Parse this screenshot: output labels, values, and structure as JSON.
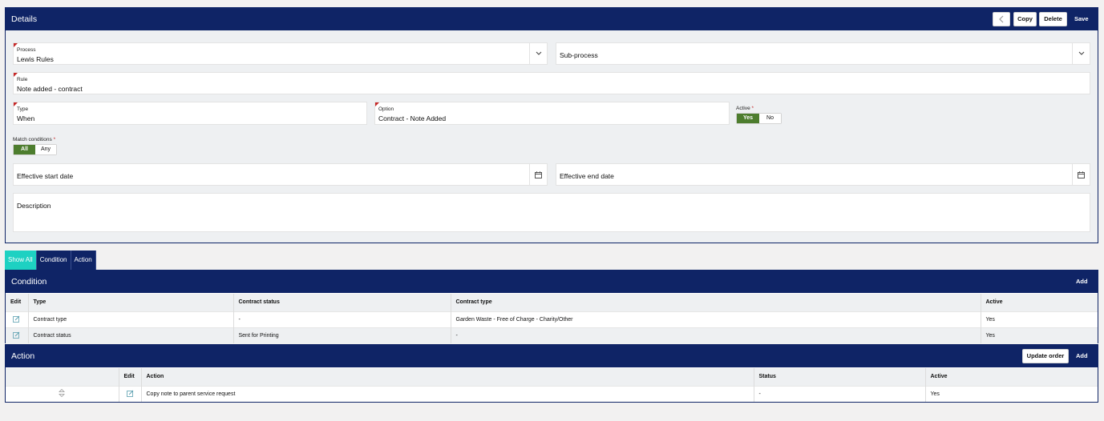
{
  "details": {
    "title": "Details",
    "buttons": {
      "back": "back-icon",
      "copy": "Copy",
      "delete": "Delete",
      "save": "Save"
    },
    "process": {
      "label": "Process",
      "value": "Lewis Rules"
    },
    "subprocess": {
      "placeholder": "Sub-process"
    },
    "rule": {
      "label": "Rule",
      "value": "Note added - contract"
    },
    "type": {
      "label": "Type",
      "value": "When"
    },
    "option": {
      "label": "Option",
      "value": "Contract - Note Added"
    },
    "active": {
      "label": "Active",
      "required": "*",
      "yes": "Yes",
      "no": "No",
      "selected": "Yes"
    },
    "match": {
      "label": "Match conditions",
      "required": "*",
      "all": "All",
      "any": "Any",
      "selected": "All"
    },
    "start_date": {
      "placeholder": "Effective start date"
    },
    "end_date": {
      "placeholder": "Effective end date"
    },
    "description": {
      "placeholder": "Description"
    }
  },
  "tabs": [
    {
      "label": "Show All",
      "active": true
    },
    {
      "label": "Condition",
      "active": false
    },
    {
      "label": "Action",
      "active": false
    }
  ],
  "condition": {
    "title": "Condition",
    "add": "Add",
    "columns": [
      "Edit",
      "Type",
      "Contract status",
      "Contract type",
      "Active"
    ],
    "rows": [
      {
        "type": "Contract type",
        "status": "-",
        "contract_type": "Garden Waste - Free of Charge - Charity/Other",
        "active": "Yes"
      },
      {
        "type": "Contract status",
        "status": "Sent for Printing",
        "contract_type": "-",
        "active": "Yes"
      }
    ]
  },
  "action": {
    "title": "Action",
    "update_order": "Update order",
    "add": "Add",
    "columns": [
      "",
      "Edit",
      "Action",
      "Status",
      "Active"
    ],
    "rows": [
      {
        "action": "Copy note to parent service request",
        "status": "-",
        "active": "Yes"
      }
    ]
  },
  "colors": {
    "header": "#0f2466",
    "accent": "#1ed1c2",
    "toggle_on": "#4d7d2e",
    "required": "#c62828"
  }
}
